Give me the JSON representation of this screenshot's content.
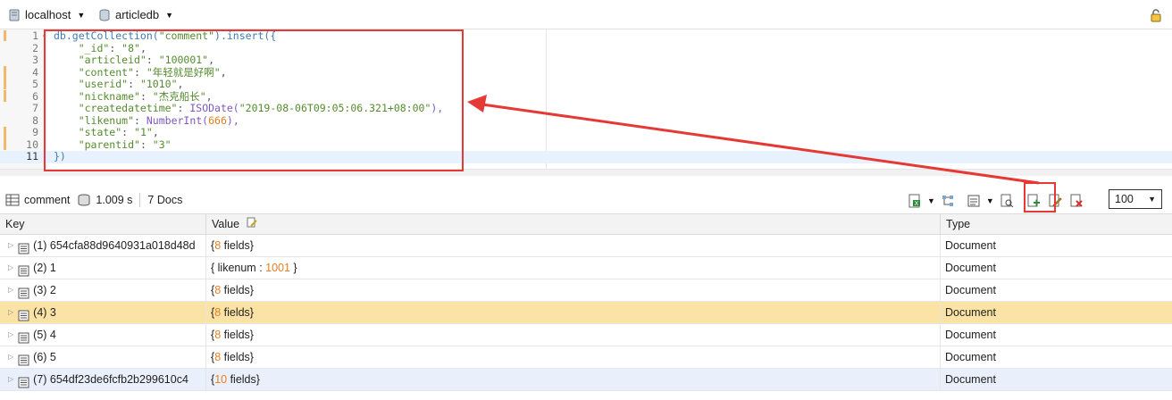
{
  "top_bar": {
    "connection": "localhost",
    "database": "articledb"
  },
  "editor": {
    "lines": [
      {
        "num": "1",
        "parts": [
          {
            "t": "db.getCollection(",
            "c": "fn"
          },
          {
            "t": "\"comment\"",
            "c": "str"
          },
          {
            "t": ").insert({",
            "c": "fn"
          }
        ]
      },
      {
        "num": "2",
        "parts": [
          {
            "t": "    \"_id\"",
            "c": "str"
          },
          {
            "t": ": ",
            "c": "punc"
          },
          {
            "t": "\"8\"",
            "c": "str"
          },
          {
            "t": ",",
            "c": "punc"
          }
        ]
      },
      {
        "num": "3",
        "parts": [
          {
            "t": "    \"articleid\"",
            "c": "str"
          },
          {
            "t": ": ",
            "c": "punc"
          },
          {
            "t": "\"100001\"",
            "c": "str"
          },
          {
            "t": ",",
            "c": "punc"
          }
        ]
      },
      {
        "num": "4",
        "parts": [
          {
            "t": "    \"content\"",
            "c": "str"
          },
          {
            "t": ": ",
            "c": "punc"
          },
          {
            "t": "\"年轻就是好啊\"",
            "c": "str"
          },
          {
            "t": ",",
            "c": "punc"
          }
        ]
      },
      {
        "num": "5",
        "parts": [
          {
            "t": "    \"userid\"",
            "c": "str"
          },
          {
            "t": ": ",
            "c": "punc"
          },
          {
            "t": "\"1010\"",
            "c": "str"
          },
          {
            "t": ",",
            "c": "punc"
          }
        ]
      },
      {
        "num": "6",
        "parts": [
          {
            "t": "    \"nickname\"",
            "c": "str"
          },
          {
            "t": ": ",
            "c": "punc"
          },
          {
            "t": "\"杰克船长\"",
            "c": "str"
          },
          {
            "t": ",",
            "c": "punc"
          }
        ]
      },
      {
        "num": "7",
        "parts": [
          {
            "t": "    \"createdatetime\"",
            "c": "str"
          },
          {
            "t": ": ",
            "c": "punc"
          },
          {
            "t": "ISODate(",
            "c": "type"
          },
          {
            "t": "\"2019-08-06T09:05:06.321+08:00\"",
            "c": "str"
          },
          {
            "t": "),",
            "c": "type"
          }
        ]
      },
      {
        "num": "8",
        "parts": [
          {
            "t": "    \"likenum\"",
            "c": "str"
          },
          {
            "t": ": ",
            "c": "punc"
          },
          {
            "t": "NumberInt(",
            "c": "type"
          },
          {
            "t": "666",
            "c": "num"
          },
          {
            "t": "),",
            "c": "type"
          }
        ]
      },
      {
        "num": "9",
        "parts": [
          {
            "t": "    \"state\"",
            "c": "str"
          },
          {
            "t": ": ",
            "c": "punc"
          },
          {
            "t": "\"1\"",
            "c": "str"
          },
          {
            "t": ",",
            "c": "punc"
          }
        ]
      },
      {
        "num": "10",
        "parts": [
          {
            "t": "    \"parentid\"",
            "c": "str"
          },
          {
            "t": ": ",
            "c": "punc"
          },
          {
            "t": "\"3\"",
            "c": "str"
          }
        ]
      },
      {
        "num": "11",
        "parts": [
          {
            "t": "})",
            "c": "fn"
          }
        ]
      }
    ]
  },
  "results": {
    "collection": "comment",
    "time": "1.009 s",
    "docs": "7 Docs",
    "page_size": "100",
    "columns": {
      "key": "Key",
      "value": "Value",
      "type": "Type"
    },
    "rows": [
      {
        "key": "(1) 654cfa88d9640931a018d48d",
        "value_pre": "{",
        "value_num": "8",
        "value_post": " fields}",
        "type": "Document"
      },
      {
        "key": "(2) 1",
        "value_pre": "{ likenum : ",
        "value_num": "1001",
        "value_post": " }",
        "type": "Document"
      },
      {
        "key": "(3) 2",
        "value_pre": "{",
        "value_num": "8",
        "value_post": " fields}",
        "type": "Document"
      },
      {
        "key": "(4) 3",
        "value_pre": "{",
        "value_num": "8",
        "value_post": " fields}",
        "type": "Document"
      },
      {
        "key": "(5) 4",
        "value_pre": "{",
        "value_num": "8",
        "value_post": " fields}",
        "type": "Document"
      },
      {
        "key": "(6) 5",
        "value_pre": "{",
        "value_num": "8",
        "value_post": " fields}",
        "type": "Document"
      },
      {
        "key": "(7) 654df23de6fcfb2b299610c4",
        "value_pre": "{",
        "value_num": "10",
        "value_post": " fields}",
        "type": "Document"
      }
    ]
  },
  "colors": {
    "annotation": "#e53935",
    "selected_row": "#fbe3a5",
    "number": "#e67e22",
    "string": "#558b2f"
  }
}
